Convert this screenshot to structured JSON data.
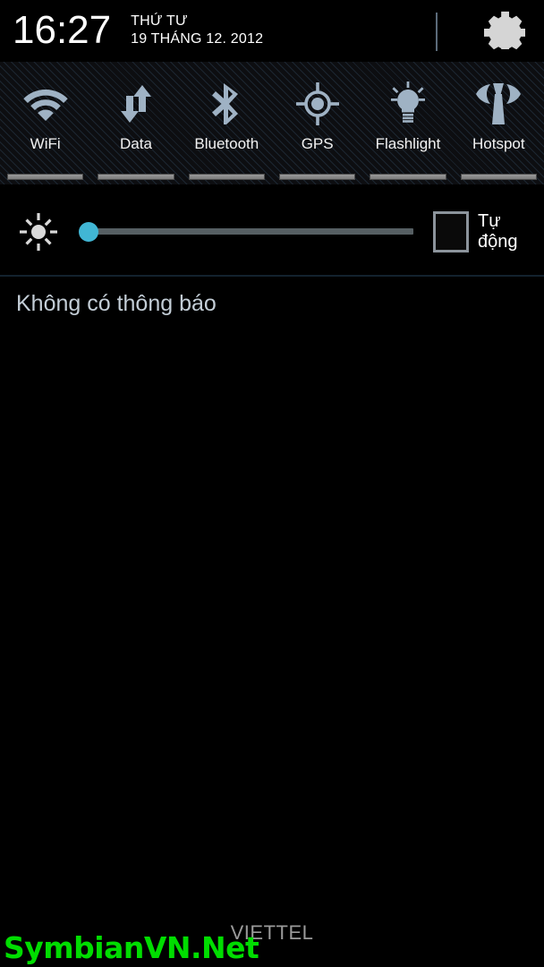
{
  "header": {
    "clock": "16:27",
    "weekday": "THỨ TƯ",
    "date": "19 THÁNG 12. 2012",
    "settings_icon": "gear-icon"
  },
  "quick_toggles": [
    {
      "label": "WiFi",
      "icon": "wifi-icon",
      "active": true
    },
    {
      "label": "Data",
      "icon": "data-icon",
      "active": true
    },
    {
      "label": "Bluetooth",
      "icon": "bluetooth-icon",
      "active": true
    },
    {
      "label": "GPS",
      "icon": "gps-icon",
      "active": true
    },
    {
      "label": "Flashlight",
      "icon": "flashlight-icon",
      "active": true
    },
    {
      "label": "Hotspot",
      "icon": "hotspot-icon",
      "active": true
    }
  ],
  "brightness": {
    "icon": "brightness-icon",
    "slider_value": 0,
    "auto_label": "Tự động",
    "auto_checked": false
  },
  "notifications": {
    "empty_text": "Không có thông báo"
  },
  "footer": {
    "carrier": "VIETTEL",
    "watermark": "SymbianVN.Net"
  },
  "colors": {
    "accent": "#41b6d4",
    "watermark": "#00dd00",
    "icon_tint": "#9fb2c4",
    "text_primary": "#ffffff",
    "notif_text": "#c3cdd6"
  }
}
